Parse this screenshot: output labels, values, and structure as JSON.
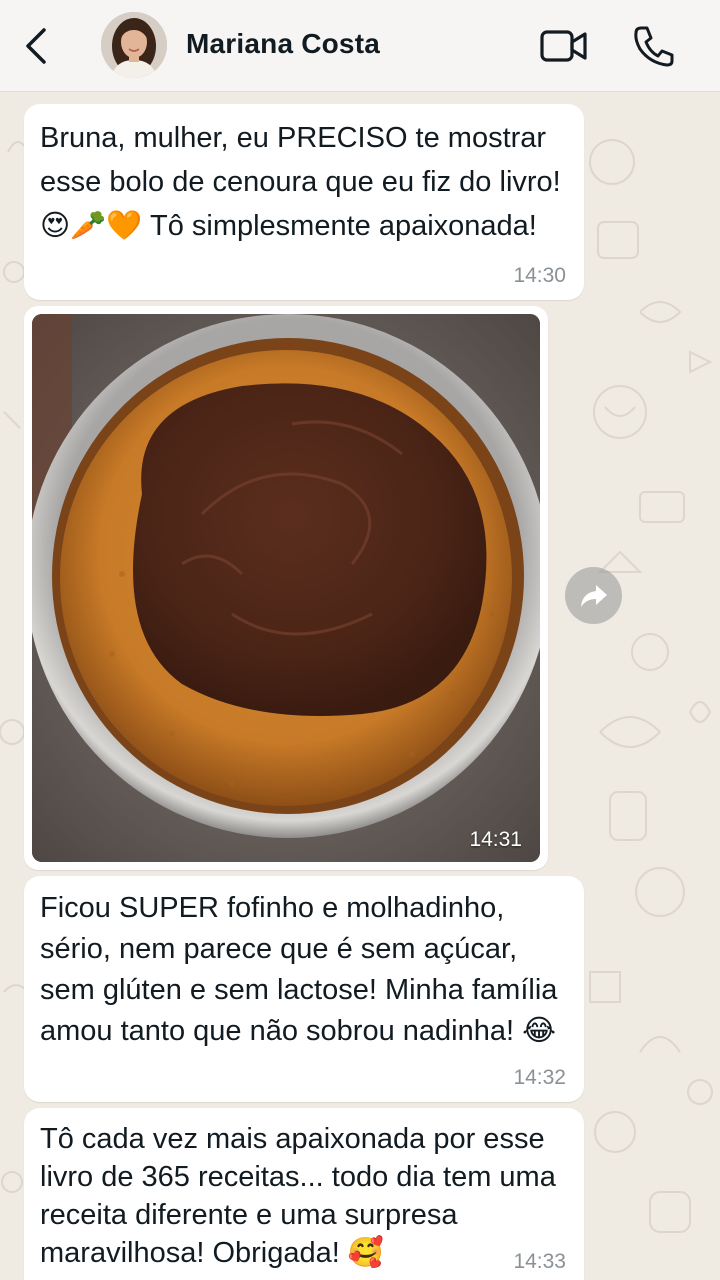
{
  "header": {
    "contact_name": "Mariana Costa",
    "icons": [
      "back-arrow-icon",
      "avatar",
      "video-call-icon",
      "phone-icon"
    ]
  },
  "messages": [
    {
      "type": "text",
      "text": "Bruna, mulher, eu PRECISO te mostrar esse bolo de cenoura que eu fiz do livro! 😍🥕🧡 Tô simplesmente apaixonada!",
      "time": "14:30"
    },
    {
      "type": "image",
      "image_description": "chocolate-topped carrot cake in round pan",
      "time": "14:31"
    },
    {
      "type": "text",
      "text": "Ficou SUPER fofinho e molhadinho, sério, nem parece que é sem açúcar, sem glúten e sem lactose! Minha família amou tanto que não sobrou nadinha! 😂",
      "time": "14:32"
    },
    {
      "type": "text",
      "text": "Tô cada vez mais apaixonada por esse livro de 365 receitas... todo dia tem uma receita diferente e uma surpresa maravilhosa! Obrigada! 🥰",
      "time": "14:33"
    }
  ],
  "colors": {
    "chat_background": "#efeae2",
    "bubble": "#ffffff",
    "header": "#f6f5f3",
    "timestamp": "#8a9196"
  }
}
